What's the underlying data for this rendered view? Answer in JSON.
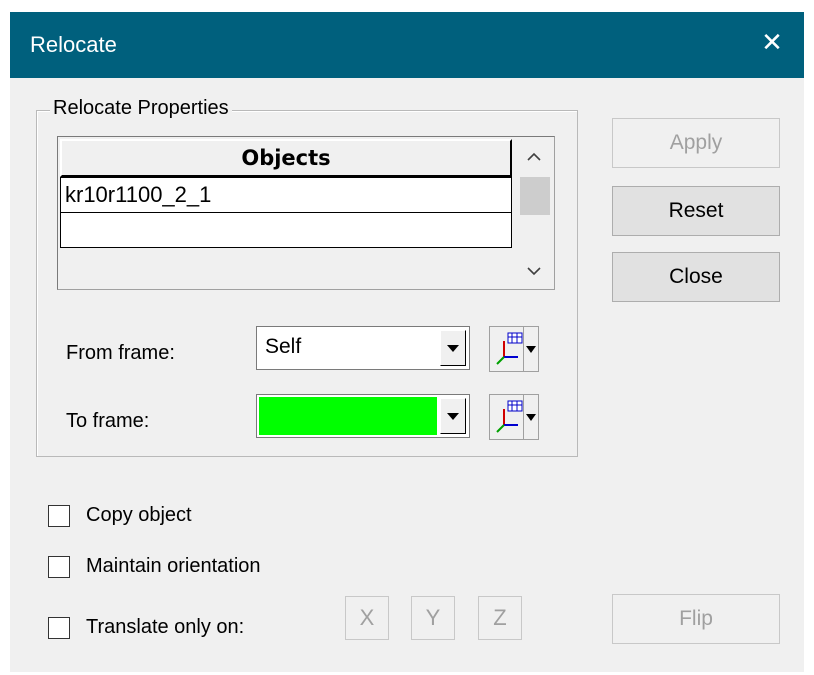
{
  "window": {
    "title": "Relocate",
    "close_glyph": "✕"
  },
  "group": {
    "label": "Relocate Properties"
  },
  "objects_grid": {
    "header": "Objects",
    "rows": [
      "kr10r1100_2_1",
      ""
    ]
  },
  "from_frame": {
    "label": "From frame:",
    "value": "Self"
  },
  "to_frame": {
    "label": "To frame:",
    "value": "",
    "fill_color": "#00ff00"
  },
  "buttons": {
    "apply": "Apply",
    "reset": "Reset",
    "close": "Close",
    "flip": "Flip"
  },
  "options": {
    "copy_object": "Copy object",
    "maintain_orientation": "Maintain orientation",
    "translate_only_on": "Translate only on:"
  },
  "axes": [
    "X",
    "Y",
    "Z"
  ],
  "icons": {
    "frame_picker": "frame-axes-icon",
    "scroll_up": "chevron-up-icon",
    "scroll_down": "chevron-down-icon"
  },
  "colors": {
    "titlebar": "#00607d",
    "dialog_bg": "#f0f0f0"
  }
}
